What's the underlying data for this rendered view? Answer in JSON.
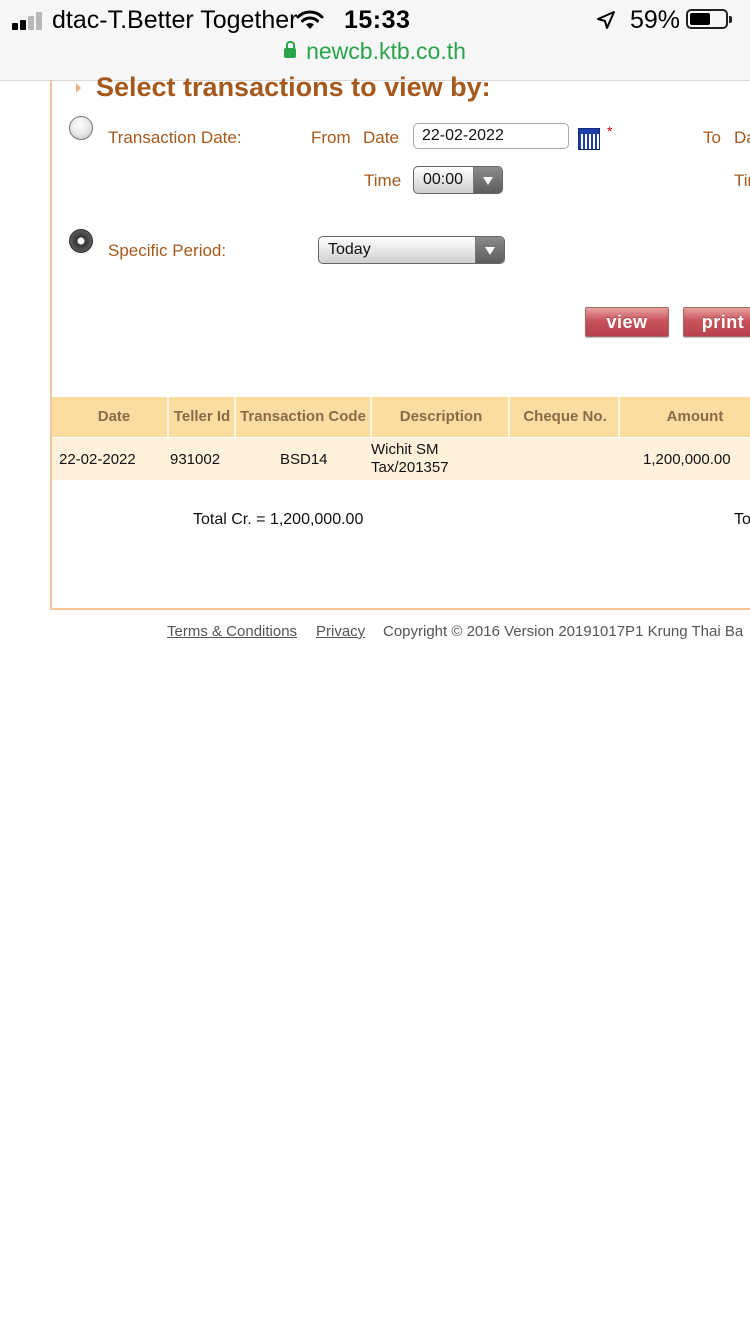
{
  "status_bar": {
    "carrier": "dtac-T.Better Together",
    "time": "15:33",
    "battery_percent_label": "59%",
    "battery_level": 0.59,
    "icons": [
      "signal-icon",
      "wifi-icon",
      "location-arrow-icon",
      "battery-icon"
    ]
  },
  "browser": {
    "url": "newcb.ktb.co.th",
    "secure_icon": "lock-icon"
  },
  "form": {
    "section_title": "Select transactions to view by:",
    "transaction_date": {
      "radio_label": "Transaction Date:",
      "from_label": "From",
      "date_label": "Date",
      "from_date_value": "22-02-2022",
      "time_label": "Time",
      "time_value": "00:00",
      "to_label": "To",
      "to_date_label": "Date",
      "to_time_label": "Time",
      "required_mark": "*"
    },
    "specific_period": {
      "radio_label": "Specific Period:",
      "selected": "Today"
    },
    "selected_option": "specific_period"
  },
  "buttons": {
    "view": "view",
    "print": "print"
  },
  "table": {
    "columns": [
      "Date",
      "Teller Id",
      "Transaction Code",
      "Description",
      "Cheque No.",
      "Amount"
    ],
    "rows": [
      {
        "date": "22-02-2022",
        "teller_id": "931002",
        "transaction_code": "BSD14",
        "description_line1": "Wichit SM",
        "description_line2": "Tax/201357",
        "cheque_no": "",
        "amount": "1,200,000.00"
      }
    ]
  },
  "totals": {
    "total_cr": "Total Cr. = 1,200,000.00",
    "total_dr_partial": "To"
  },
  "footer": {
    "terms": "Terms & Conditions",
    "privacy": "Privacy",
    "copyright": "Copyright © 2016 Version 20191017P1 Krung Thai Ba"
  },
  "colors": {
    "accent_brown": "#a5591c",
    "table_header_bg": "#fbdda1",
    "table_row_bg": "#fff1dc",
    "button_red": "#c8545d",
    "url_green": "#2aa44a"
  }
}
